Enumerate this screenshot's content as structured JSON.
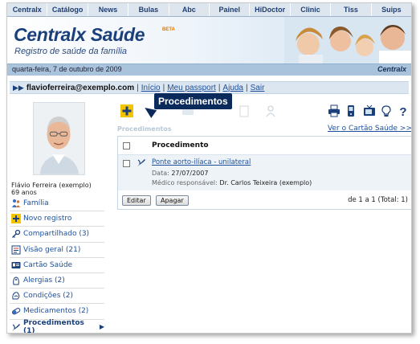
{
  "topnav": {
    "tabs": [
      "Centralx",
      "Catálogo",
      "News",
      "Bulas",
      "Abc",
      "Painel",
      "HiDoctor",
      "Clinic",
      "Tiss",
      "Suips"
    ]
  },
  "banner": {
    "title": "Centralx Saúde",
    "beta": "BETA",
    "tagline": "Registro de saúde da família",
    "date": "quarta-feira, 7 de outubro de 2009",
    "logo": "Centralx"
  },
  "userbar": {
    "email": "flavioferreira@exemplo.com",
    "links": [
      "Início",
      "Meu passport",
      "Ajuda",
      "Sair"
    ]
  },
  "patient": {
    "name": "Flávio Ferreira (exemplo)",
    "age": "69 anos"
  },
  "sidebar": {
    "items": [
      {
        "label": "Família",
        "icon": "family-icon"
      },
      {
        "label": "Novo registro",
        "icon": "plus-icon"
      },
      {
        "label": "Compartilhado (3)",
        "icon": "key-icon"
      },
      {
        "label": "Visão geral (21)",
        "icon": "overview-icon"
      },
      {
        "label": "Cartão Saúde",
        "icon": "card-icon"
      },
      {
        "label": "Alergias (2)",
        "icon": "allergy-icon"
      },
      {
        "label": "Condições (2)",
        "icon": "condition-icon"
      },
      {
        "label": "Medicamentos (2)",
        "icon": "pill-icon"
      },
      {
        "label": "Procedimentos (1)",
        "icon": "scalpel-icon",
        "active": true
      }
    ]
  },
  "toolbar": {
    "tooltip": "Procedimentos",
    "right_icons": [
      "print-icon",
      "mobile-icon",
      "tv-icon",
      "tip-icon",
      "help-icon"
    ]
  },
  "section": {
    "title": "Procedimentos",
    "link": "Ver o Cartão Saúde >>"
  },
  "table": {
    "header": "Procedimento",
    "rows": [
      {
        "name": "Ponte aorto-ilíaca - unilateral",
        "date_label": "Data:",
        "date": "27/07/2007",
        "doctor_label": "Médico responsável:",
        "doctor": "Dr. Carlos Teixeira (exemplo)"
      }
    ],
    "edit_label": "Editar",
    "delete_label": "Apagar",
    "count": "de 1 a 1 (Total: 1)"
  },
  "colors": {
    "brand_blue": "#1a3f7a",
    "link_blue": "#1d4f9a",
    "nav_bg": "#dde6ee",
    "tooltip_bg": "#0b2a5c",
    "row_bg": "#eef3f8"
  }
}
